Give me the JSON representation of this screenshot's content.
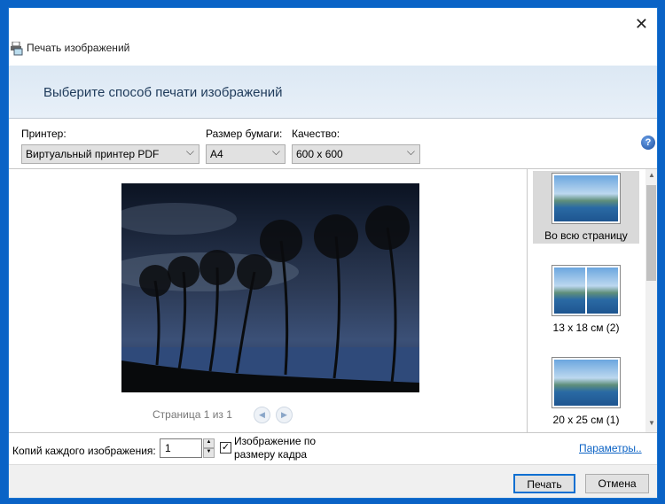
{
  "window": {
    "title": "Печать изображений",
    "close_icon": "close-icon"
  },
  "header": {
    "title": "Выберите способ печати изображений"
  },
  "printer": {
    "label": "Принтер:",
    "value": "Виртуальный принтер PDF"
  },
  "paper": {
    "label": "Размер бумаги:",
    "value": "A4"
  },
  "quality": {
    "label": "Качество:",
    "value": "600 x 600"
  },
  "preview": {
    "page_text": "Страница 1 из 1"
  },
  "layouts": [
    {
      "label": "Во всю страницу",
      "selected": true
    },
    {
      "label": "13 x 18 см (2)"
    },
    {
      "label": "20 x 25 см (1)"
    }
  ],
  "bottom": {
    "copies_label": "Копий каждого изображения:",
    "copies_value": "1",
    "fit_label_1": "Изображение по",
    "fit_label_2": "размеру кадра",
    "fit_checked": true,
    "options_link": "Параметры.."
  },
  "footer": {
    "print": "Печать",
    "cancel": "Отмена"
  }
}
